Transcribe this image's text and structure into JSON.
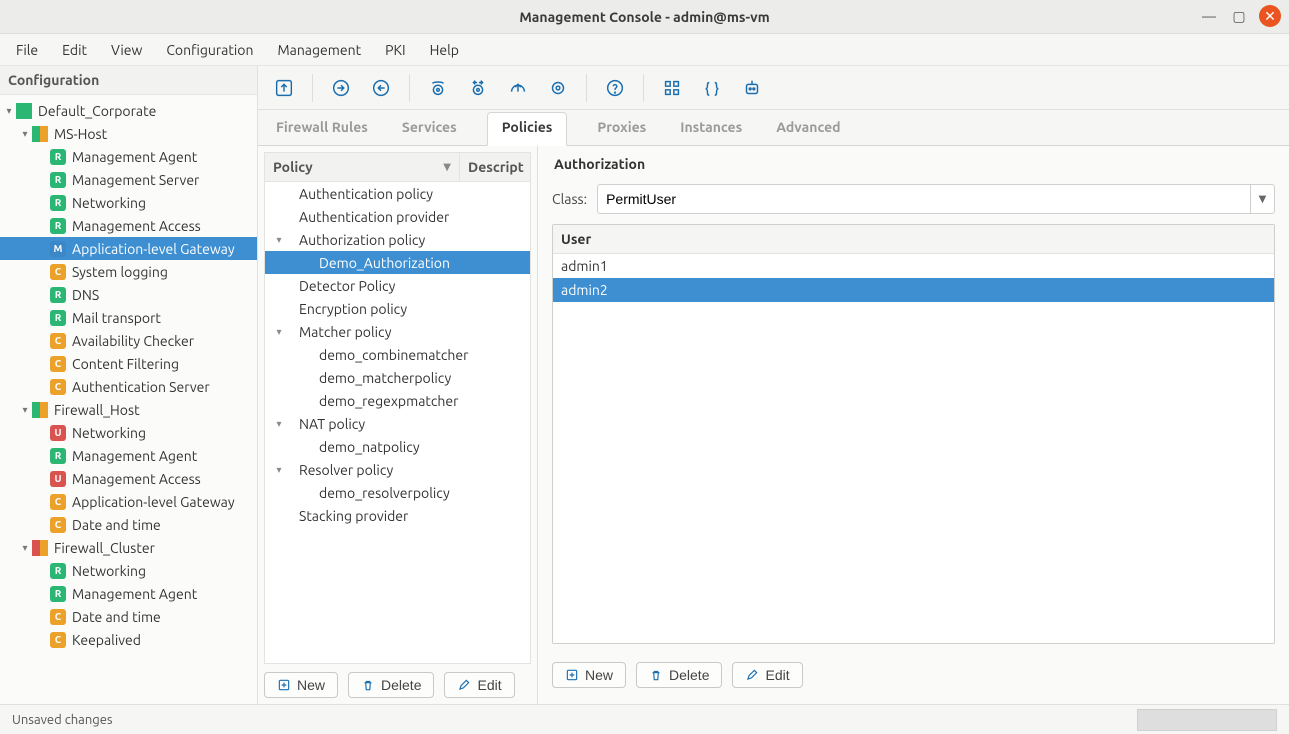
{
  "window": {
    "title": "Management Console - admin@ms-vm"
  },
  "menu": [
    "File",
    "Edit",
    "View",
    "Configuration",
    "Management",
    "PKI",
    "Help"
  ],
  "sidebar": {
    "header": "Configuration",
    "root": {
      "label": "Default_Corporate",
      "hosts": [
        {
          "label": "MS-Host",
          "dual": "gy",
          "children": [
            {
              "tag": "R",
              "label": "Management Agent"
            },
            {
              "tag": "R",
              "label": "Management Server"
            },
            {
              "tag": "R",
              "label": "Networking"
            },
            {
              "tag": "R",
              "label": "Management Access"
            },
            {
              "tag": "M",
              "label": "Application-level Gateway",
              "selected": true
            },
            {
              "tag": "C",
              "label": "System logging"
            },
            {
              "tag": "R",
              "label": "DNS"
            },
            {
              "tag": "R",
              "label": "Mail transport"
            },
            {
              "tag": "C",
              "label": "Availability Checker"
            },
            {
              "tag": "C",
              "label": "Content Filtering"
            },
            {
              "tag": "C",
              "label": "Authentication Server"
            }
          ]
        },
        {
          "label": "Firewall_Host",
          "dual": "gy",
          "children": [
            {
              "tag": "U",
              "label": "Networking"
            },
            {
              "tag": "R",
              "label": "Management Agent"
            },
            {
              "tag": "U",
              "label": "Management Access"
            },
            {
              "tag": "C",
              "label": "Application-level Gateway"
            },
            {
              "tag": "C",
              "label": "Date and time"
            }
          ]
        },
        {
          "label": "Firewall_Cluster",
          "dual": "ry",
          "children": [
            {
              "tag": "R",
              "label": "Networking"
            },
            {
              "tag": "R",
              "label": "Management Agent"
            },
            {
              "tag": "C",
              "label": "Date and time"
            },
            {
              "tag": "C",
              "label": "Keepalived"
            }
          ]
        }
      ]
    }
  },
  "tabs": [
    "Firewall Rules",
    "Services",
    "Policies",
    "Proxies",
    "Instances",
    "Advanced"
  ],
  "tabs_active": 2,
  "policies": {
    "col_policy": "Policy",
    "col_desc": "Descript",
    "groups": [
      {
        "label": "Authentication policy",
        "children": []
      },
      {
        "label": "Authentication provider",
        "children": []
      },
      {
        "label": "Authorization policy",
        "expanded": true,
        "children": [
          {
            "label": "Demo_Authorization",
            "selected": true
          }
        ]
      },
      {
        "label": "Detector Policy",
        "children": []
      },
      {
        "label": "Encryption policy",
        "children": []
      },
      {
        "label": "Matcher policy",
        "expanded": true,
        "children": [
          {
            "label": "demo_combinematcher"
          },
          {
            "label": "demo_matcherpolicy"
          },
          {
            "label": "demo_regexpmatcher"
          }
        ]
      },
      {
        "label": "NAT policy",
        "expanded": true,
        "children": [
          {
            "label": "demo_natpolicy"
          }
        ]
      },
      {
        "label": "Resolver policy",
        "expanded": true,
        "children": [
          {
            "label": "demo_resolverpolicy"
          }
        ]
      },
      {
        "label": "Stacking provider",
        "children": []
      }
    ],
    "buttons": {
      "new": "New",
      "delete": "Delete",
      "edit": "Edit"
    }
  },
  "detail": {
    "title": "Authorization",
    "class_label": "Class:",
    "class_value": "PermitUser",
    "user_header": "User",
    "users": [
      "admin1",
      "admin2"
    ],
    "selected_user_index": 1,
    "buttons": {
      "new": "New",
      "delete": "Delete",
      "edit": "Edit"
    }
  },
  "status": {
    "text": "Unsaved changes"
  }
}
